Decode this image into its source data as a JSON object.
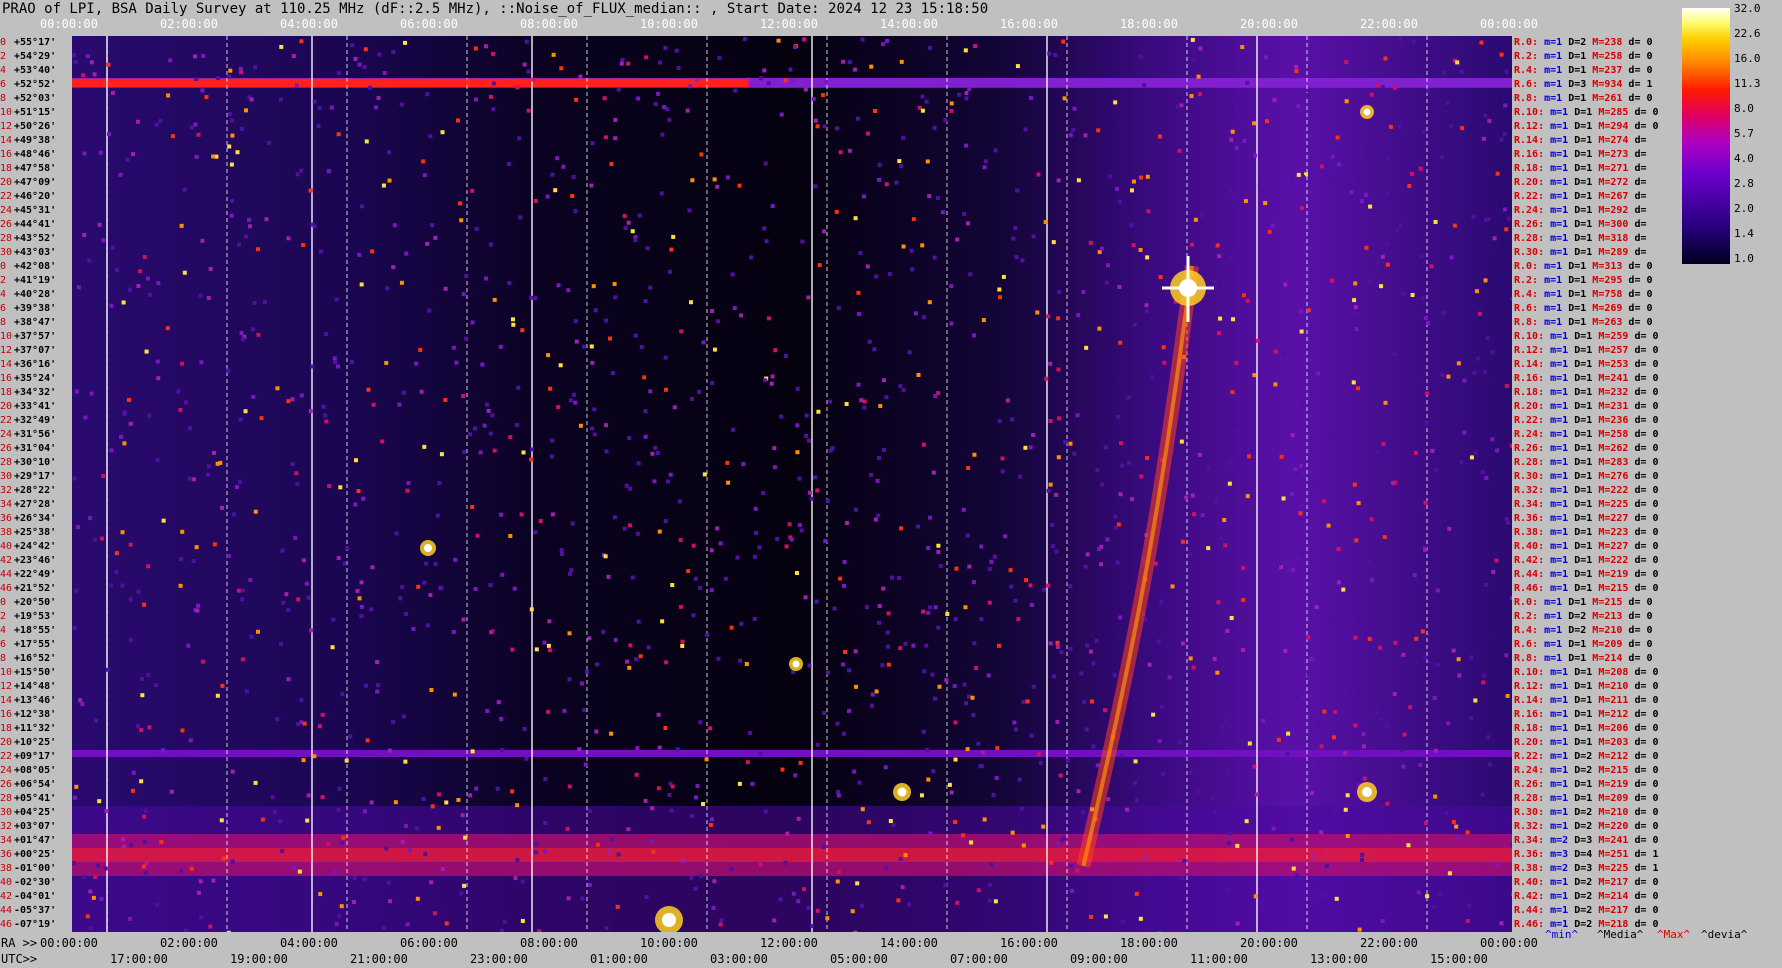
{
  "title": "PRAO of LPI, BSA Daily Survey at 110.25 MHz (dF::2.5 MHz), ::Noise_of_FLUX_median:: , Start Date: 2024 12 23 15:18:50",
  "chart_data": {
    "type": "heatmap",
    "x_top_ticks": [
      "00:00:00",
      "02:00:00",
      "04:00:00",
      "06:00:00",
      "08:00:00",
      "10:00:00",
      "12:00:00",
      "14:00:00",
      "16:00:00",
      "18:00:00",
      "20:00:00",
      "22:00:00",
      "00:00:00"
    ],
    "x_ra_ticks": [
      "00:00:00",
      "02:00:00",
      "04:00:00",
      "06:00:00",
      "08:00:00",
      "10:00:00",
      "12:00:00",
      "14:00:00",
      "16:00:00",
      "18:00:00",
      "20:00:00",
      "22:00:00",
      "00:00:00"
    ],
    "x_utc_ticks": [
      "17:00:00",
      "19:00:00",
      "21:00:00",
      "23:00:00",
      "01:00:00",
      "03:00:00",
      "05:00:00",
      "07:00:00",
      "09:00:00",
      "11:00:00",
      "13:00:00",
      "15:00:00"
    ],
    "ra_label": "RA >>",
    "utc_label": "UTC>>",
    "colorbar_ticks": [
      "32.0",
      "22.6",
      "16.0",
      "11.3",
      "8.0",
      "5.7",
      "4.0",
      "2.8",
      "2.0",
      "1.4",
      "1.0"
    ],
    "colorbar_min": 1.0,
    "colorbar_max": 32.0,
    "colorbar_scale": "log",
    "declinations": [
      "+55°17'",
      "+54°29'",
      "+53°40'",
      "+52°52'",
      "+52°03'",
      "+51°15'",
      "+50°26'",
      "+49°38'",
      "+48°46'",
      "+47°58'",
      "+47°09'",
      "+46°20'",
      "+45°31'",
      "+44°41'",
      "+43°52'",
      "+43°03'",
      "+42°08'",
      "+41°19'",
      "+40°28'",
      "+39°38'",
      "+38°47'",
      "+37°57'",
      "+37°07'",
      "+36°16'",
      "+35°24'",
      "+34°32'",
      "+33°41'",
      "+32°49'",
      "+31°56'",
      "+31°04'",
      "+30°10'",
      "+29°17'",
      "+28°22'",
      "+27°28'",
      "+26°34'",
      "+25°38'",
      "+24°42'",
      "+23°46'",
      "+22°49'",
      "+21°52'",
      "+20°50'",
      "+19°53'",
      "+18°55'",
      "+17°55'",
      "+16°52'",
      "+15°50'",
      "+14°48'",
      "+13°46'",
      "+12°38'",
      "+11°32'",
      "+10°25'",
      "+09°17'",
      "+08°05'",
      "+06°54'",
      "+05°41'",
      "+04°25'",
      "+03°07'",
      "+01°47'",
      "+00°25'",
      "-01°00'",
      "-02°30'",
      "-04°01'",
      "-05°37'",
      "-07°19'"
    ],
    "row_indices": [
      "0",
      "2",
      "4",
      "6",
      "8",
      "10",
      "12",
      "14",
      "16",
      "18",
      "20",
      "22",
      "24",
      "26",
      "28",
      "30",
      "0",
      "2",
      "4",
      "6",
      "8",
      "10",
      "12",
      "14",
      "16",
      "18",
      "20",
      "22",
      "24",
      "26",
      "28",
      "30",
      "32",
      "34",
      "36",
      "38",
      "40",
      "42",
      "44",
      "46",
      "0",
      "2",
      "4",
      "6",
      "8",
      "10",
      "12",
      "14",
      "16",
      "18",
      "20",
      "22",
      "24",
      "26",
      "28",
      "30",
      "32",
      "34",
      "36",
      "38",
      "40",
      "42",
      "44",
      "46"
    ],
    "row_stats": [
      [
        "R.0:",
        "1",
        "2",
        "238",
        "0"
      ],
      [
        "R.2:",
        "1",
        "1",
        "258",
        "0"
      ],
      [
        "R.4:",
        "1",
        "1",
        "237",
        "0"
      ],
      [
        "R.6:",
        "1",
        "3",
        "934",
        "1"
      ],
      [
        "R.8:",
        "1",
        "1",
        "261",
        "0"
      ],
      [
        "R.10:",
        "1",
        "1",
        "285",
        "0"
      ],
      [
        "R.12:",
        "1",
        "1",
        "294",
        "0"
      ],
      [
        "R.14:",
        "1",
        "1",
        "274",
        ""
      ],
      [
        "R.16:",
        "1",
        "1",
        "273",
        ""
      ],
      [
        "R.18:",
        "1",
        "1",
        "271",
        ""
      ],
      [
        "R.20:",
        "1",
        "1",
        "272",
        ""
      ],
      [
        "R.22:",
        "1",
        "1",
        "267",
        ""
      ],
      [
        "R.24:",
        "1",
        "1",
        "292",
        ""
      ],
      [
        "R.26:",
        "1",
        "1",
        "300",
        ""
      ],
      [
        "R.28:",
        "1",
        "1",
        "318",
        ""
      ],
      [
        "R.30:",
        "1",
        "1",
        "289",
        ""
      ],
      [
        "R.0:",
        "1",
        "1",
        "313",
        "0"
      ],
      [
        "R.2:",
        "1",
        "1",
        "295",
        "0"
      ],
      [
        "R.4:",
        "1",
        "1",
        "758",
        "0"
      ],
      [
        "R.6:",
        "1",
        "1",
        "269",
        "0"
      ],
      [
        "R.8:",
        "1",
        "1",
        "263",
        "0"
      ],
      [
        "R.10:",
        "1",
        "1",
        "259",
        "0"
      ],
      [
        "R.12:",
        "1",
        "1",
        "257",
        "0"
      ],
      [
        "R.14:",
        "1",
        "1",
        "253",
        "0"
      ],
      [
        "R.16:",
        "1",
        "1",
        "241",
        "0"
      ],
      [
        "R.18:",
        "1",
        "1",
        "232",
        "0"
      ],
      [
        "R.20:",
        "1",
        "1",
        "231",
        "0"
      ],
      [
        "R.22:",
        "1",
        "1",
        "236",
        "0"
      ],
      [
        "R.24:",
        "1",
        "1",
        "258",
        "0"
      ],
      [
        "R.26:",
        "1",
        "1",
        "262",
        "0"
      ],
      [
        "R.28:",
        "1",
        "1",
        "283",
        "0"
      ],
      [
        "R.30:",
        "1",
        "1",
        "276",
        "0"
      ],
      [
        "R.32:",
        "1",
        "1",
        "222",
        "0"
      ],
      [
        "R.34:",
        "1",
        "1",
        "225",
        "0"
      ],
      [
        "R.36:",
        "1",
        "1",
        "227",
        "0"
      ],
      [
        "R.38:",
        "1",
        "1",
        "223",
        "0"
      ],
      [
        "R.40:",
        "1",
        "1",
        "227",
        "0"
      ],
      [
        "R.42:",
        "1",
        "1",
        "222",
        "0"
      ],
      [
        "R.44:",
        "1",
        "1",
        "219",
        "0"
      ],
      [
        "R.46:",
        "1",
        "1",
        "215",
        "0"
      ],
      [
        "R.0:",
        "1",
        "1",
        "215",
        "0"
      ],
      [
        "R.2:",
        "1",
        "2",
        "213",
        "0"
      ],
      [
        "R.4:",
        "1",
        "2",
        "210",
        "0"
      ],
      [
        "R.6:",
        "1",
        "1",
        "209",
        "0"
      ],
      [
        "R.8:",
        "1",
        "1",
        "214",
        "0"
      ],
      [
        "R.10:",
        "1",
        "1",
        "208",
        "0"
      ],
      [
        "R.12:",
        "1",
        "1",
        "210",
        "0"
      ],
      [
        "R.14:",
        "1",
        "1",
        "211",
        "0"
      ],
      [
        "R.16:",
        "1",
        "1",
        "212",
        "0"
      ],
      [
        "R.18:",
        "1",
        "1",
        "206",
        "0"
      ],
      [
        "R.20:",
        "1",
        "1",
        "203",
        "0"
      ],
      [
        "R.22:",
        "1",
        "2",
        "212",
        "0"
      ],
      [
        "R.24:",
        "1",
        "2",
        "215",
        "0"
      ],
      [
        "R.26:",
        "1",
        "1",
        "219",
        "0"
      ],
      [
        "R.28:",
        "1",
        "1",
        "209",
        "0"
      ],
      [
        "R.30:",
        "1",
        "2",
        "210",
        "0"
      ],
      [
        "R.32:",
        "1",
        "2",
        "220",
        "0"
      ],
      [
        "R.34:",
        "2",
        "3",
        "241",
        "0"
      ],
      [
        "R.36:",
        "3",
        "4",
        "251",
        "1"
      ],
      [
        "R.38:",
        "2",
        "3",
        "225",
        "1"
      ],
      [
        "R.40:",
        "1",
        "2",
        "217",
        "0"
      ],
      [
        "R.42:",
        "1",
        "2",
        "214",
        "0"
      ],
      [
        "R.44:",
        "1",
        "2",
        "217",
        "0"
      ],
      [
        "R.46:",
        "1",
        "2",
        "218",
        "0"
      ]
    ],
    "legend": {
      "min": "^min^",
      "median": "^Media^",
      "max": "^Max^",
      "devia": "^devia^"
    },
    "colors": {
      "min": "#0000cc",
      "median": "#000000",
      "max": "#d40000",
      "devia": "#000000"
    }
  }
}
